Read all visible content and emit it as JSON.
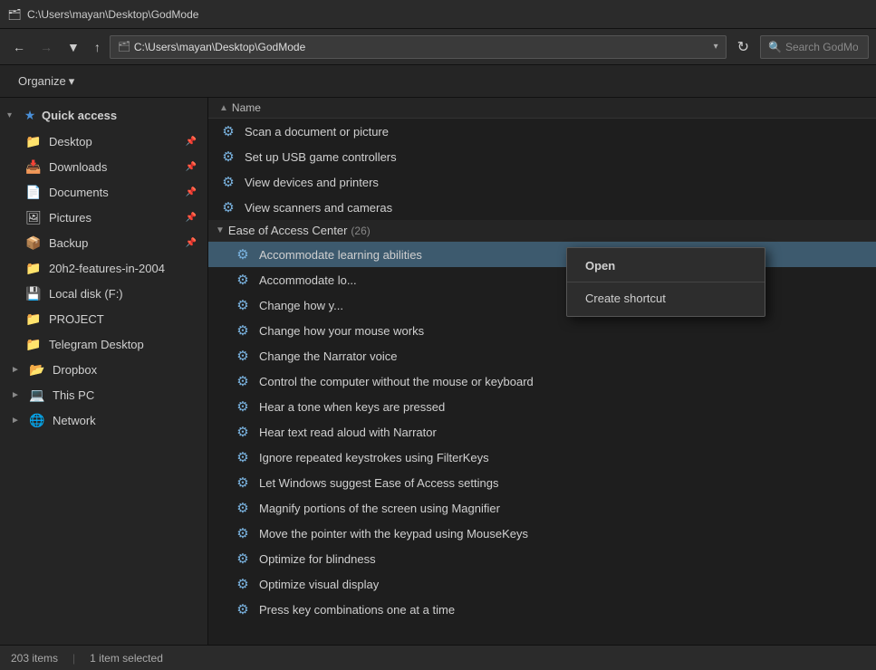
{
  "titlebar": {
    "icon": "🗂",
    "title": "C:\\Users\\mayan\\Desktop\\GodMode"
  },
  "toolbar": {
    "back_tooltip": "Back",
    "forward_tooltip": "Forward",
    "recent_tooltip": "Recent locations",
    "up_tooltip": "Up",
    "address_icon": "🗂",
    "address_text": "C:\\Users\\mayan\\Desktop\\GodMode",
    "refresh_tooltip": "Refresh",
    "search_placeholder": "Search GodMode"
  },
  "organize_bar": {
    "organize_label": "Organize",
    "dropdown_icon": "▾"
  },
  "sidebar": {
    "quick_access": {
      "label": "Quick access",
      "chevron": "▾"
    },
    "items": [
      {
        "id": "desktop",
        "label": "Desktop",
        "icon": "📁",
        "pinned": true
      },
      {
        "id": "downloads",
        "label": "Downloads",
        "icon": "📥",
        "pinned": true
      },
      {
        "id": "documents",
        "label": "Documents",
        "icon": "📄",
        "pinned": true
      },
      {
        "id": "pictures",
        "label": "Pictures",
        "icon": "🖼",
        "pinned": true
      },
      {
        "id": "backup",
        "label": "Backup",
        "icon": "📦",
        "pinned": true
      },
      {
        "id": "20h2",
        "label": "20h2-features-in-2004",
        "icon": "📁",
        "pinned": false
      },
      {
        "id": "localdisk",
        "label": "Local disk (F:)",
        "icon": "💾",
        "pinned": false
      },
      {
        "id": "project",
        "label": "PROJECT",
        "icon": "📁",
        "pinned": false
      },
      {
        "id": "telegram",
        "label": "Telegram Desktop",
        "icon": "📁",
        "pinned": false
      }
    ],
    "dropbox": {
      "label": "Dropbox",
      "icon": "📦"
    },
    "thispc": {
      "label": "This PC",
      "icon": "💻"
    },
    "network": {
      "label": "Network",
      "icon": "🌐"
    }
  },
  "column_header": {
    "sort_icon": "▲",
    "name_label": "Name"
  },
  "file_list": {
    "top_items": [
      {
        "icon": "⚙",
        "name": "Scan a document or picture"
      },
      {
        "icon": "⚙",
        "name": "Set up USB game controllers"
      },
      {
        "icon": "⚙",
        "name": "View devices and printers"
      },
      {
        "icon": "⚙",
        "name": "View scanners and cameras"
      }
    ],
    "category": {
      "chevron": "▾",
      "name": "Ease of Access Center",
      "count": "(26)"
    },
    "ease_items": [
      {
        "icon": "⚙",
        "name": "Accommodate learning abilities",
        "selected": true
      },
      {
        "icon": "⚙",
        "name": "Accommodate lo..."
      },
      {
        "icon": "⚙",
        "name": "Change how y..."
      },
      {
        "icon": "⚙",
        "name": "Change how your mouse works"
      },
      {
        "icon": "⚙",
        "name": "Change the Narrator voice"
      },
      {
        "icon": "⚙",
        "name": "Control the computer without the mouse or keyboard"
      },
      {
        "icon": "⚙",
        "name": "Hear a tone when keys are pressed"
      },
      {
        "icon": "⚙",
        "name": "Hear text read aloud with Narrator"
      },
      {
        "icon": "⚙",
        "name": "Ignore repeated keystrokes using FilterKeys"
      },
      {
        "icon": "⚙",
        "name": "Let Windows suggest Ease of Access settings"
      },
      {
        "icon": "⚙",
        "name": "Magnify portions of the screen using Magnifier"
      },
      {
        "icon": "⚙",
        "name": "Move the pointer with the keypad using MouseKeys"
      },
      {
        "icon": "⚙",
        "name": "Optimize for blindness"
      },
      {
        "icon": "⚙",
        "name": "Optimize visual display"
      },
      {
        "icon": "⚙",
        "name": "Press key combinations one at a time"
      }
    ]
  },
  "context_menu": {
    "open_label": "Open",
    "separator": "",
    "create_shortcut_label": "Create shortcut"
  },
  "status_bar": {
    "item_count": "203 items",
    "separator": "|",
    "selected_count": "1 item selected"
  }
}
